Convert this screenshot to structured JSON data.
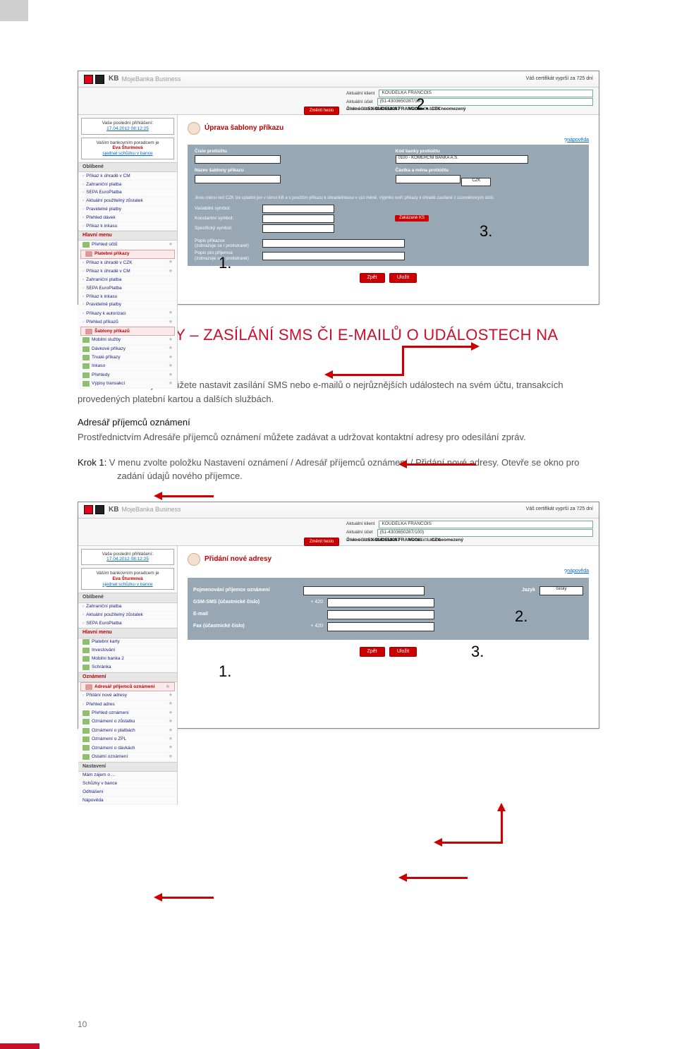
{
  "page_number": "10",
  "heading": "PRVNÍ KROKY – ZASÍLÁNÍ SMS ČI E-MAILŮ O UDÁLOSTECH NA ÚČTU",
  "para_intro": "Pomocí této služby si můžete nastavit zasílání SMS nebo e-mailů o nejrůznějších událostech na svém účtu, transakcích provedených platební kartou a dalších službách.",
  "sect_title": "Adresář příjemců oznámení",
  "para_sect": "Prostřednictvím Adresáře příjemců oznámení můžete zadávat a udržovat kontaktní adresy pro odesílání zpráv.",
  "krok_label": "Krok 1:",
  "krok_text_a": " V menu zvolte položku ",
  "krok_strong1": "Nastavení oznámení / Adresář příjemců oznámení / Přidání nové adresy",
  "krok_text_b": ". Otevře se okno pro zadání údajů nového příjemce.",
  "marks": {
    "n1": "1.",
    "n2": "2.",
    "n3": "3."
  },
  "app": {
    "kb": "KB",
    "name": "MojeBanka Business",
    "cert": "Váš certifikát vyprší za 725 dní",
    "client_lbl": "Aktuální klient",
    "client_val": "KOUDELKA FRANCOIS",
    "acct_lbl": "Aktuální účet",
    "acct_val": "(51-4303650287/100)",
    "acctno_lbl": "Číslo účtu:",
    "acctno_val": "51-4343658287",
    "currency_lbl": "Měna účtu:",
    "currency_val": "CZK",
    "holder_lbl": "Jméno účtu:",
    "holder_val": "KOUDELKA FRANCOIS",
    "limit_lbl": "Limit:",
    "limit_val": "neomezený",
    "zmenit": "Změnit heslo",
    "lastlogin_lbl": "Vaše poslední přihlášení:",
    "lastlogin_val": "17.04.2012 08:12:25",
    "advisor_lbl": "Vaším bankovním poradcem je",
    "advisor_val": "Eva Šturmová",
    "advisor_link": "sjednat schůzku v bance",
    "help": "nápověda",
    "zpet": "Zpět",
    "ulozit": "Uložit"
  },
  "menu1": {
    "oblibene": "Oblíbené",
    "items_ob": [
      "Příkaz k úhradě v CM",
      "Zahraniční platba",
      "SEPA EuroPlatba",
      "Aktuální použitelný zůstatek",
      "Pravidelné platby",
      "Přehled dávek",
      "Příkaz k inkasu"
    ],
    "hlavni": "Hlavní menu",
    "prehled": "Přehled účtů",
    "platebni": "Platební příkazy",
    "items_pp": [
      "Příkaz k úhradě v CZK",
      "Příkaz k úhradě v CM",
      "Zahraniční platba",
      "SEPA EuroPlatba",
      "Příkaz k inkasu",
      "Pravidelné platby",
      "Příkazy k autorizaci",
      "Přehled příkazů"
    ],
    "sablony": "Šablony příkazů",
    "tail": [
      "Mobilní služby",
      "Dávkové příkazy",
      "Trvalé příkazy",
      "Inkaso",
      "Přehledy",
      "Výpisy transakcí"
    ]
  },
  "form1": {
    "title": "Úprava šablony příkazu",
    "cislo": "Číslo protiúčtu",
    "kod": "Kód banky protiúčtu",
    "kod_val": "0100 - KOMERCNI BANKA A.S.",
    "nazev": "Název šablony příkazu",
    "castka": "Částka a měna protiúčtu",
    "czk": "CZK",
    "notice": "Jinou měnu než CZK lze uplatnit jen v rámci KB a s použitím příkazu k úhradě/inkasu v cizí měně. Výjimku tvoří příkazy k úhradě zasílané z cizoměnových účtů.",
    "vs": "Variabilní symbol:",
    "ks": "Konstantní symbol:",
    "ss": "Specifický symbol:",
    "zak": "Zakázané KS",
    "popis1": "Popis příkazce",
    "popis1b": "(zobrazuje se i protistraně)",
    "popis2": "Popis pro příjemce",
    "popis2b": "(zobrazuje se i protistraně)"
  },
  "menu2": {
    "oblibene": "Oblíbené",
    "items_ob": [
      "Zahraniční platba",
      "Aktuální použitelný zůstatek",
      "SEPA EuroPlatba"
    ],
    "hlavni": "Hlavní menu",
    "tail1": [
      "Platební karty",
      "Investování",
      "Mobilní banka 2",
      "Schránka"
    ],
    "ozn": "Oznámení",
    "adr": "Adresář příjemců oznámení",
    "items_adr": [
      "Přidání nové adresy",
      "Přehled adres"
    ],
    "po": "Přehled oznámení",
    "items_oz": [
      "Oznámení o zůstatku",
      "Oznámení o platbách",
      "Oznámení o ZPL",
      "Oznámení o dávkách",
      "Ostatní oznámení"
    ],
    "tail2": [
      "Nastavení",
      "Mám zájem o ...",
      "Schůzky v bance",
      "Odhlášení",
      "Nápověda"
    ]
  },
  "form2": {
    "title": "Přidání nové adresy",
    "pojm": "Pojmenování příjemce oznámení",
    "jazyk": "Jazyk",
    "jazyk_val": "česky",
    "gsm": "GSM-SMS (účastnické číslo)",
    "p420": "+ 420",
    "email": "E-mail",
    "fax": "Fax (účastnické číslo)"
  }
}
